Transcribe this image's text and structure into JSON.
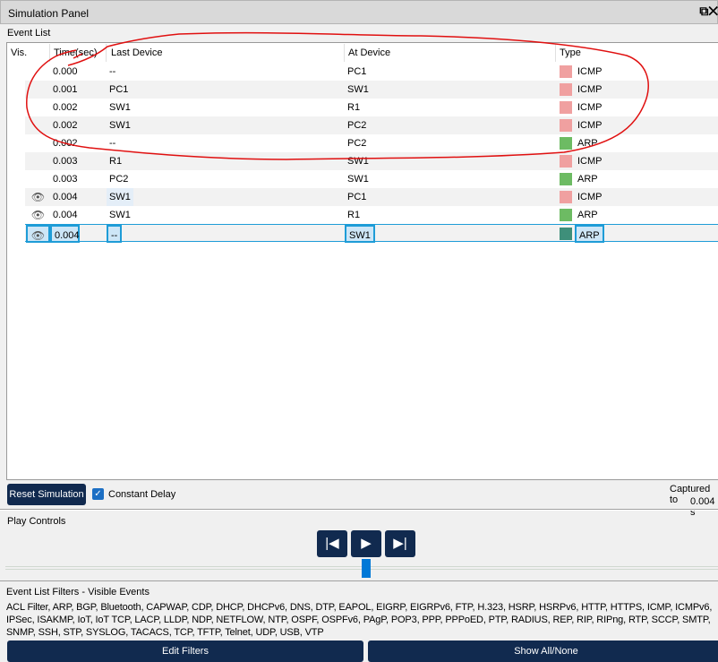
{
  "window": {
    "title": "Simulation Panel",
    "restore_icon": "restore-window-icon",
    "close_icon": "close-icon"
  },
  "event_list": {
    "label": "Event List",
    "columns": [
      "Vis.",
      "Time(sec)",
      "Last Device",
      "At Device",
      "Type"
    ],
    "rows": [
      {
        "vis": false,
        "time": "0.000",
        "last": "--",
        "at": "PC1",
        "type": "ICMP",
        "color": "#f0a0a0"
      },
      {
        "vis": false,
        "time": "0.001",
        "last": "PC1",
        "at": "SW1",
        "type": "ICMP",
        "color": "#f0a0a0"
      },
      {
        "vis": false,
        "time": "0.002",
        "last": "SW1",
        "at": "R1",
        "type": "ICMP",
        "color": "#f0a0a0"
      },
      {
        "vis": false,
        "time": "0.002",
        "last": "SW1",
        "at": "PC2",
        "type": "ICMP",
        "color": "#f0a0a0"
      },
      {
        "vis": false,
        "time": "0.002",
        "last": "--",
        "at": "PC2",
        "type": "ARP",
        "color": "#6dbb63"
      },
      {
        "vis": false,
        "time": "0.003",
        "last": "R1",
        "at": "SW1",
        "type": "ICMP",
        "color": "#f0a0a0"
      },
      {
        "vis": false,
        "time": "0.003",
        "last": "PC2",
        "at": "SW1",
        "type": "ARP",
        "color": "#6dbb63"
      },
      {
        "vis": true,
        "time": "0.004",
        "last": "SW1",
        "at": "PC1",
        "type": "ICMP",
        "color": "#f0a0a0"
      },
      {
        "vis": true,
        "time": "0.004",
        "last": "SW1",
        "at": "R1",
        "type": "ARP",
        "color": "#6dbb63"
      },
      {
        "vis": true,
        "time": "0.004",
        "last": "--",
        "at": "SW1",
        "type": "ARP",
        "color": "#3e8f7a",
        "selected": true
      }
    ]
  },
  "controls": {
    "reset_label": "Reset Simulation",
    "constant_delay_label": "Constant Delay",
    "constant_delay_checked": true,
    "captured_label": "Captured to",
    "captured_value": "0.004 s"
  },
  "play": {
    "label": "Play Controls",
    "back_icon": "skip-back-icon",
    "play_icon": "play-icon",
    "forward_icon": "skip-forward-icon"
  },
  "filters": {
    "label": "Event List Filters - Visible Events",
    "text": "ACL Filter, ARP, BGP, Bluetooth, CAPWAP, CDP, DHCP, DHCPv6, DNS, DTP, EAPOL, EIGRP, EIGRPv6, FTP, H.323, HSRP, HSRPv6, HTTP, HTTPS, ICMP, ICMPv6, IPSec, ISAKMP, IoT, IoT TCP, LACP, LLDP, NDP, NETFLOW, NTP, OSPF, OSPFv6, PAgP, POP3, PPP, PPPoED, PTP, RADIUS, REP, RIP, RIPng, RTP, SCCP, SMTP, SNMP, SSH, STP, SYSLOG, TACACS, TCP, TFTP, Telnet, UDP, USB, VTP",
    "edit_label": "Edit Filters",
    "show_all_label": "Show All/None"
  },
  "annotation": {
    "color": "#e01010"
  }
}
